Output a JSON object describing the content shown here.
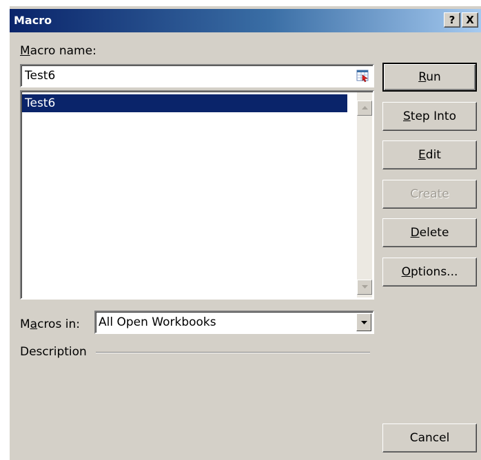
{
  "window": {
    "title": "Macro",
    "help_label": "?",
    "close_label": "X"
  },
  "macro_name": {
    "label_underlined": "M",
    "label_rest": "acro name:",
    "value": "Test6",
    "icon": "collapse-dialog-icon"
  },
  "macro_list": {
    "items": [
      {
        "label": "Test6",
        "selected": true
      }
    ]
  },
  "buttons": {
    "run": {
      "underlined": "R",
      "rest": "un",
      "enabled": true,
      "default": true
    },
    "step_into": {
      "underlined": "S",
      "rest": "tep Into",
      "enabled": true
    },
    "edit": {
      "underlined": "E",
      "rest": "dit",
      "enabled": true
    },
    "create": {
      "label": "Create",
      "enabled": false
    },
    "delete": {
      "underlined": "D",
      "rest": "elete",
      "enabled": true
    },
    "options": {
      "underlined": "O",
      "rest": "ptions...",
      "enabled": true
    },
    "cancel": {
      "label": "Cancel",
      "enabled": true
    }
  },
  "macros_in": {
    "label_pre": "M",
    "label_underlined": "a",
    "label_rest": "cros in:",
    "selected": "All Open Workbooks"
  },
  "description": {
    "label": "Description"
  },
  "colors": {
    "selection": "#0a246a",
    "face": "#d4d0c8"
  }
}
